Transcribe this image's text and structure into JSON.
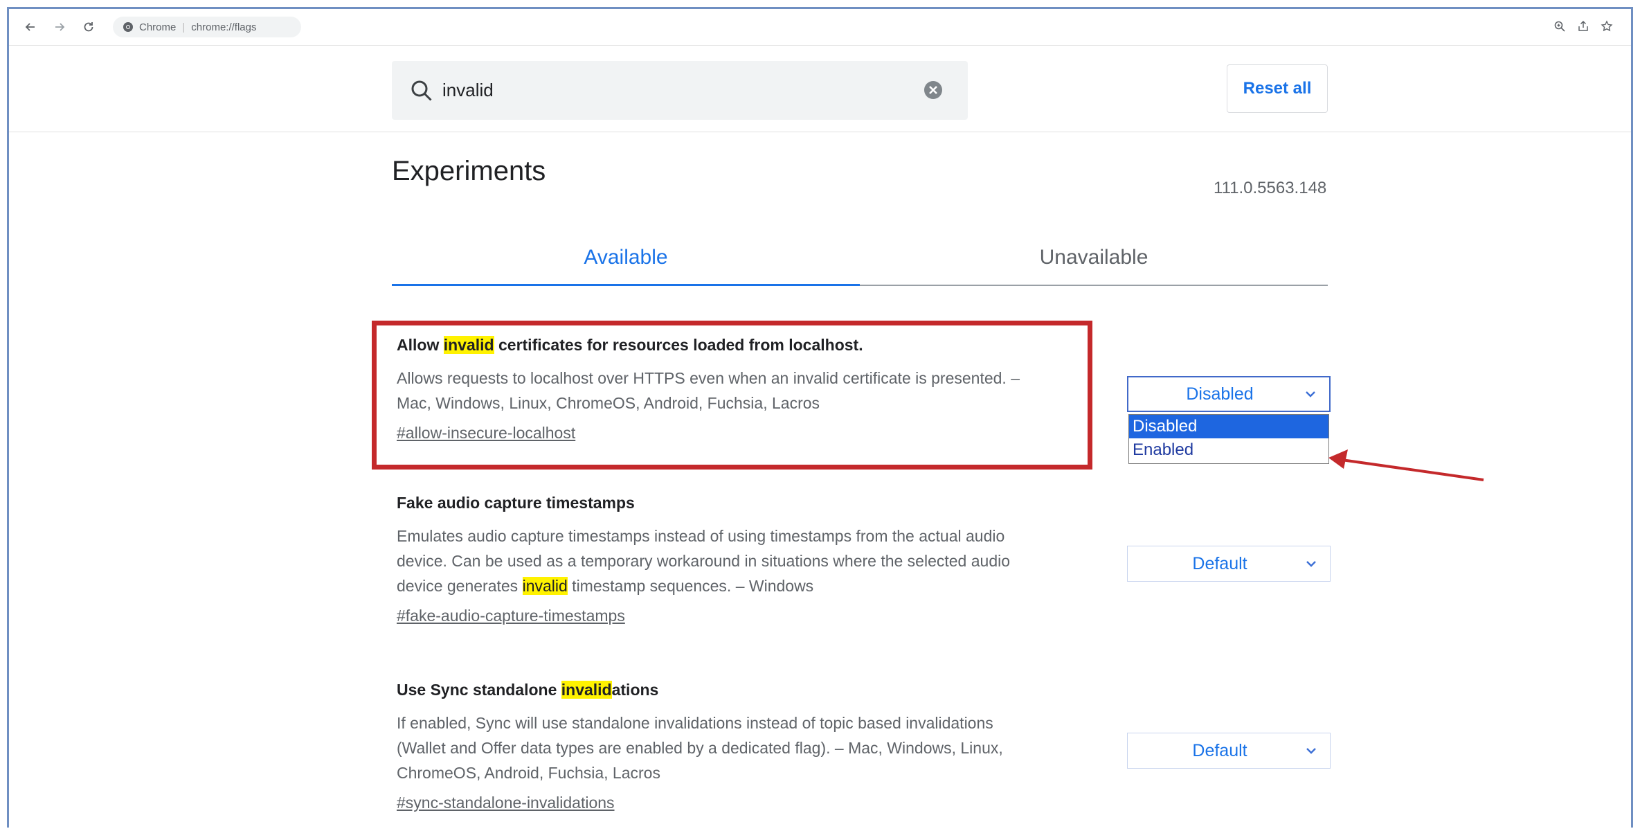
{
  "browser": {
    "site_name": "Chrome",
    "url": "chrome://flags"
  },
  "search": {
    "value": "invalid"
  },
  "header": {
    "reset_label": "Reset all"
  },
  "page": {
    "title": "Experiments",
    "version": "111.0.5563.148"
  },
  "tabs": [
    {
      "label": "Available",
      "active": true
    },
    {
      "label": "Unavailable",
      "active": false
    }
  ],
  "experiments": [
    {
      "title_pre": "Allow ",
      "title_hl": "invalid",
      "title_post": " certificates for resources loaded from localhost.",
      "desc_line1": "Allows requests to localhost over HTTPS even when an invalid certificate is presented. –",
      "desc_line2": "Mac, Windows, Linux, ChromeOS, Android, Fuchsia, Lacros",
      "link": "#allow-insecure-localhost",
      "selected": "Disabled",
      "options": [
        "Disabled",
        "Enabled"
      ]
    },
    {
      "title": "Fake audio capture timestamps",
      "desc_line1": "Emulates audio capture timestamps instead of using timestamps from the actual audio",
      "desc_line2": "device. Can be used as a temporary workaround in situations where the selected audio",
      "desc_line3_pre": "device generates ",
      "desc_line3_hl": "invalid",
      "desc_line3_post": " timestamp sequences. – Windows",
      "link": "#fake-audio-capture-timestamps",
      "selected": "Default"
    },
    {
      "title_pre": "Use Sync standalone ",
      "title_hl": "invalid",
      "title_post": "ations",
      "desc_line1": "If enabled, Sync will use standalone invalidations instead of topic based invalidations",
      "desc_line2": "(Wallet and Offer data types are enabled by a dedicated flag). – Mac, Windows, Linux,",
      "desc_line3": "ChromeOS, Android, Fuchsia, Lacros",
      "link": "#sync-standalone-invalidations",
      "selected": "Default"
    }
  ],
  "colors": {
    "accent": "#1a73e8",
    "highlight": "#fff200",
    "annotation_red": "#c4292b"
  }
}
